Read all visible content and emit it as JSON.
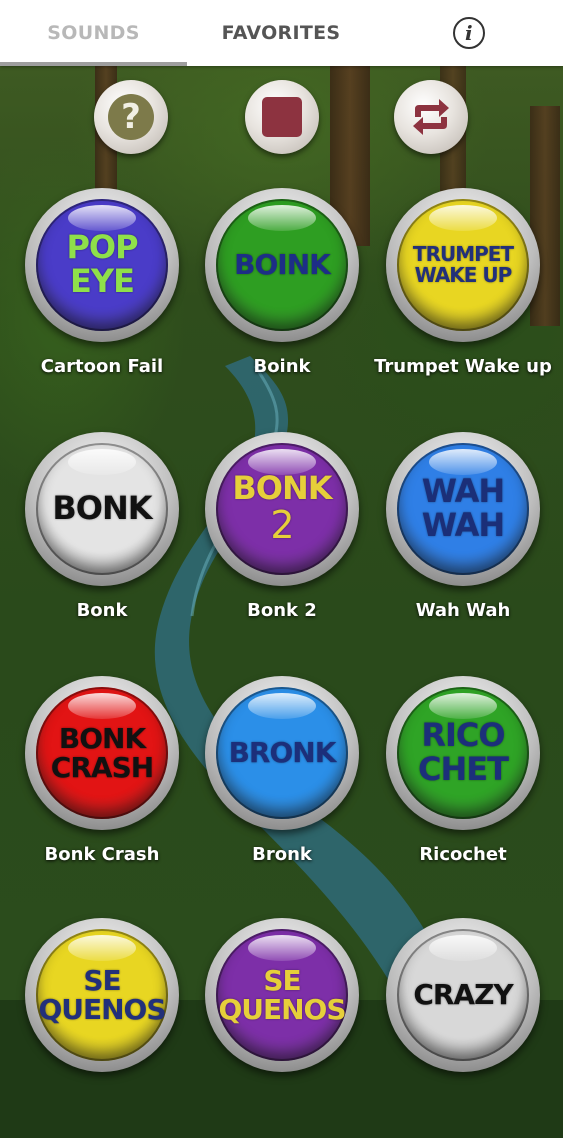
{
  "tabs": {
    "sounds": "SOUNDS",
    "favorites": "FAVORITES",
    "info_icon": "info-icon"
  },
  "controls": {
    "help_icon": "help-icon",
    "help_glyph": "?",
    "stop_icon": "stop-icon",
    "repeat_icon": "repeat-icon"
  },
  "sounds": [
    {
      "label": "Cartoon Fail",
      "face_lines": [
        "POP",
        "EYE"
      ],
      "color": "#4a3cc8",
      "text_color": "#8fe04a"
    },
    {
      "label": "Boink",
      "face_lines": [
        "BOINK"
      ],
      "color": "#2e9e22",
      "text_color": "#1d2e86"
    },
    {
      "label": "Trumpet Wake up",
      "face_lines": [
        "TRUMPET",
        "WAKE UP"
      ],
      "color": "#e8d622",
      "text_color": "#22307a"
    },
    {
      "label": "Bonk",
      "face_lines": [
        "BONK"
      ],
      "color": "#e4e4e4",
      "text_color": "#111111"
    },
    {
      "label": "Bonk 2",
      "face_lines": [
        "BONK",
        "2"
      ],
      "color": "#7d2fa8",
      "text_color": "#e6cf3a"
    },
    {
      "label": "Wah Wah",
      "face_lines": [
        "WAH",
        "WAH"
      ],
      "color": "#2f7fe6",
      "text_color": "#1b2f78"
    },
    {
      "label": "Bonk Crash",
      "face_lines": [
        "BONK",
        "CRASH"
      ],
      "color": "#e21414",
      "text_color": "#111111"
    },
    {
      "label": "Bronk",
      "face_lines": [
        "BRONK"
      ],
      "color": "#2b8fe8",
      "text_color": "#1c2f7a"
    },
    {
      "label": "Ricochet",
      "face_lines": [
        "RICO",
        "CHET"
      ],
      "color": "#2fa426",
      "text_color": "#1c2f7a"
    },
    {
      "label": "",
      "face_lines": [
        "SE",
        "QUENOS"
      ],
      "color": "#e8d622",
      "text_color": "#22307a"
    },
    {
      "label": "",
      "face_lines": [
        "SE",
        "QUENOS"
      ],
      "color": "#7d2fa8",
      "text_color": "#e6cf3a"
    },
    {
      "label": "",
      "face_lines": [
        "CRAZY"
      ],
      "color": "#d8d8d8",
      "text_color": "#111111"
    }
  ]
}
